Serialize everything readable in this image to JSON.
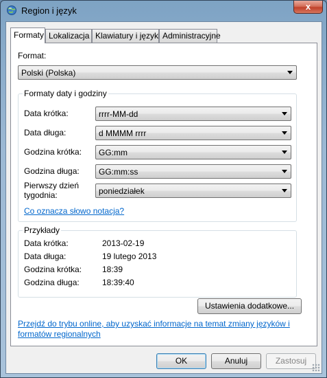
{
  "window": {
    "title": "Region i język",
    "close_glyph": "x"
  },
  "tabs": [
    {
      "label": "Formaty",
      "active": true
    },
    {
      "label": "Lokalizacja",
      "active": false
    },
    {
      "label": "Klawiatury i języki",
      "active": false
    },
    {
      "label": "Administracyjne",
      "active": false
    }
  ],
  "format": {
    "label": "Format:",
    "value": "Polski (Polska)"
  },
  "datetime_group": {
    "title": "Formaty daty i godziny",
    "rows": [
      {
        "label": "Data krótka:",
        "value": "rrrr-MM-dd"
      },
      {
        "label": "Data długa:",
        "value": "d MMMM rrrr"
      },
      {
        "label": "Godzina krótka:",
        "value": "GG:mm"
      },
      {
        "label": "Godzina długa:",
        "value": "GG:mm:ss"
      },
      {
        "label_line1": "Pierwszy dzień",
        "label_line2": "tygodnia:",
        "value": "poniedziałek"
      }
    ],
    "notation_link": "Co oznacza słowo notacja?"
  },
  "examples_group": {
    "title": "Przykłady",
    "rows": [
      {
        "label": "Data krótka:",
        "value": "2013-02-19"
      },
      {
        "label": "Data długa:",
        "value": "19 lutego 2013"
      },
      {
        "label": "Godzina krótka:",
        "value": "18:39"
      },
      {
        "label": "Godzina długa:",
        "value": "18:39:40"
      }
    ]
  },
  "additional_settings_button": "Ustawienia dodatkowe...",
  "online_link": {
    "line1": "Przejdź do trybu online, aby uzyskać informacje na temat zmiany języków i",
    "line2": "formatów regionalnych"
  },
  "footer": {
    "ok": "OK",
    "cancel": "Anuluj",
    "apply": "Zastosuj"
  },
  "colors": {
    "link": "#0066cc",
    "group_border": "#d5dfe5",
    "close_button": "#c0412a"
  }
}
